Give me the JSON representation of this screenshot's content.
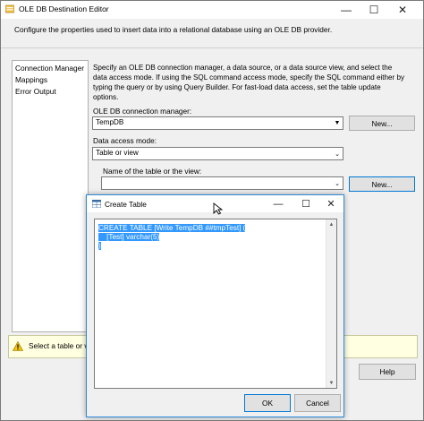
{
  "main_window": {
    "title": "OLE DB Destination Editor",
    "controls": {
      "minimize": "—",
      "maximize": "☐",
      "close": "✕"
    },
    "description": "Configure the properties used to insert data into a relational database using an OLE DB provider.",
    "nav_items": [
      {
        "label": "Connection Manager"
      },
      {
        "label": "Mappings"
      },
      {
        "label": "Error Output"
      }
    ],
    "section_description": "Specify an OLE DB connection manager, a data source, or a data source view, and select the data access mode. If using the SQL command access mode, specify the SQL command either by typing the query or by using Query Builder. For fast-load data access, set the table update options.",
    "connection_manager": {
      "label": "OLE DB connection manager:",
      "value": "TempDB",
      "new_button": "New..."
    },
    "data_access_mode": {
      "label": "Data access mode:",
      "value": "Table or view"
    },
    "table_name": {
      "label": "Name of the table or the view:",
      "value": "",
      "new_button": "New..."
    },
    "status": {
      "text": "Select a table or view"
    },
    "buttons": {
      "help": "Help"
    }
  },
  "dialog": {
    "title": "Create Table",
    "controls": {
      "minimize": "—",
      "maximize": "☐",
      "close": "✕"
    },
    "sql_lines": [
      "CREATE TABLE [Write TempDB ##tmpTest] (",
      "    [Test] varchar(5)",
      ")"
    ],
    "buttons": {
      "ok": "OK",
      "cancel": "Cancel"
    }
  },
  "colors": {
    "accent": "#2b8ad8",
    "selection": "#3399ff",
    "status_bg": "#ffffe1",
    "warning": "#f5c400"
  }
}
